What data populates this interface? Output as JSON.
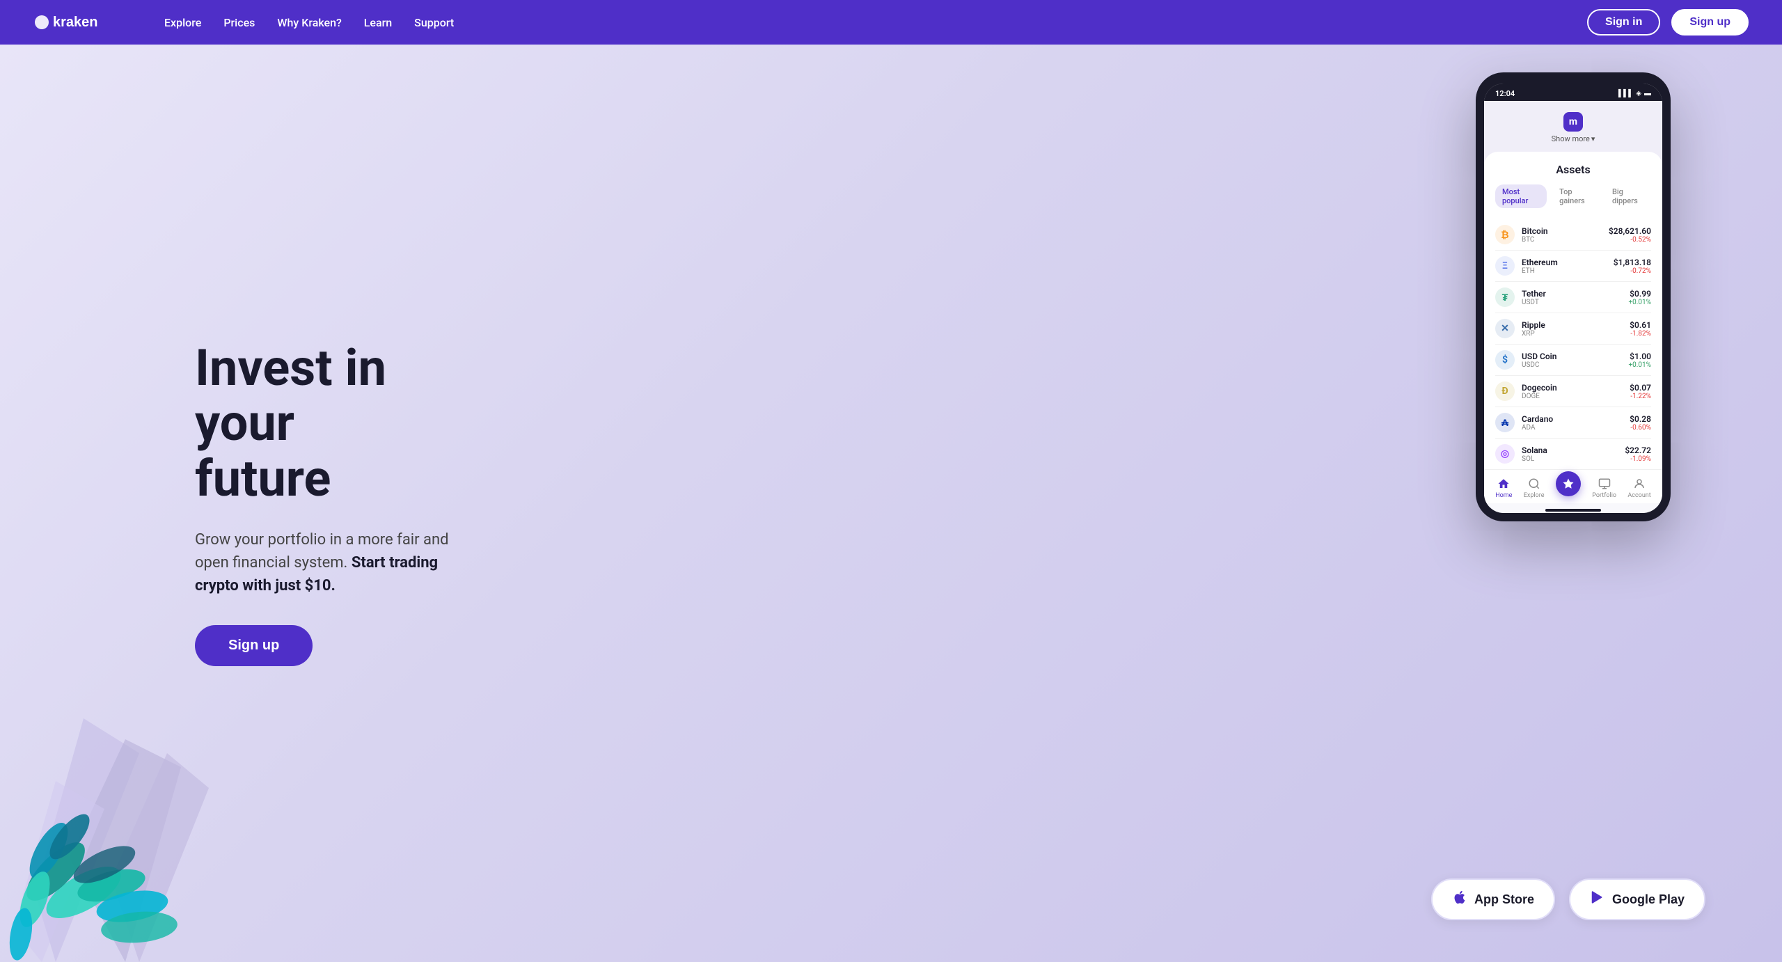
{
  "nav": {
    "logo_text": "mkraken",
    "links": [
      {
        "label": "Explore",
        "name": "explore"
      },
      {
        "label": "Prices",
        "name": "prices"
      },
      {
        "label": "Why Kraken?",
        "name": "why-kraken"
      },
      {
        "label": "Learn",
        "name": "learn"
      },
      {
        "label": "Support",
        "name": "support"
      }
    ],
    "signin_label": "Sign in",
    "signup_label": "Sign up"
  },
  "hero": {
    "title_line1": "Invest in your",
    "title_line2": "future",
    "subtitle_plain": "Grow your portfolio in a more fair and open financial system.",
    "subtitle_bold": "Start trading crypto with just $10.",
    "signup_label": "Sign up"
  },
  "phone": {
    "time": "12:04",
    "show_more": "Show more",
    "assets_title": "Assets",
    "tabs": [
      {
        "label": "Most popular",
        "active": true
      },
      {
        "label": "Top gainers",
        "active": false
      },
      {
        "label": "Big dippers",
        "active": false
      }
    ],
    "assets": [
      {
        "name": "Bitcoin",
        "ticker": "BTC",
        "price": "$28,621.60",
        "change": "-0.52%",
        "direction": "down",
        "color": "#f7931a",
        "symbol": "₿"
      },
      {
        "name": "Ethereum",
        "ticker": "ETH",
        "price": "$1,813.18",
        "change": "-0.72%",
        "direction": "down",
        "color": "#627eea",
        "symbol": "Ξ"
      },
      {
        "name": "Tether",
        "ticker": "USDT",
        "price": "$0.99",
        "change": "+0.01%",
        "direction": "up",
        "color": "#26a17b",
        "symbol": "₮"
      },
      {
        "name": "Ripple",
        "ticker": "XRP",
        "price": "$0.61",
        "change": "-1.82%",
        "direction": "down",
        "color": "#346aa9",
        "symbol": "✕"
      },
      {
        "name": "USD Coin",
        "ticker": "USDC",
        "price": "$1.00",
        "change": "+0.01%",
        "direction": "up",
        "color": "#2775ca",
        "symbol": "$"
      },
      {
        "name": "Dogecoin",
        "ticker": "DOGE",
        "price": "$0.07",
        "change": "-1.22%",
        "direction": "down",
        "color": "#c2a633",
        "symbol": "Ð"
      },
      {
        "name": "Cardano",
        "ticker": "ADA",
        "price": "$0.28",
        "change": "-0.60%",
        "direction": "down",
        "color": "#0033ad",
        "symbol": "₳"
      },
      {
        "name": "Solana",
        "ticker": "SOL",
        "price": "$22.72",
        "change": "-1.09%",
        "direction": "down",
        "color": "#9945ff",
        "symbol": "◎"
      }
    ],
    "bottom_nav": [
      {
        "label": "Home",
        "active": true,
        "icon": "🏠"
      },
      {
        "label": "Explore",
        "active": false,
        "icon": "🔍"
      },
      {
        "label": "",
        "active": false,
        "icon": "⚡",
        "center": true
      },
      {
        "label": "Portfolio",
        "active": false,
        "icon": "📊"
      },
      {
        "label": "Account",
        "active": false,
        "icon": "👤"
      }
    ]
  },
  "store_buttons": {
    "app_store_label": "App Store",
    "google_play_label": "Google Play"
  }
}
